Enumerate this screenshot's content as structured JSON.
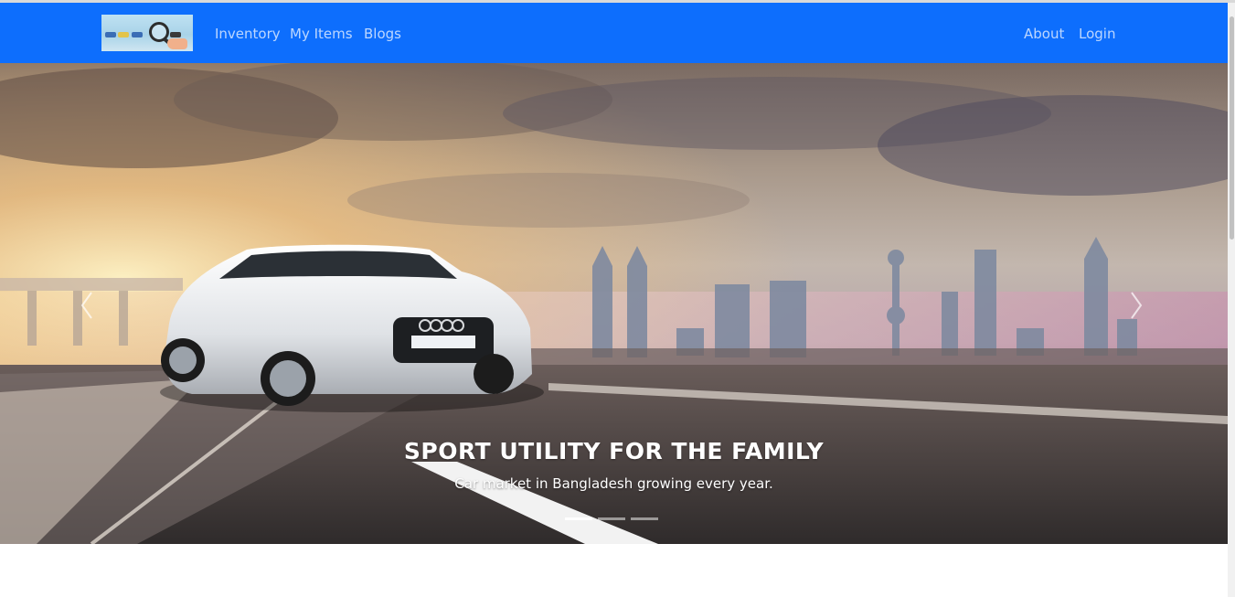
{
  "navbar": {
    "background": "#0d6efd",
    "left_links": [
      "Inventory",
      "My Items",
      "Blogs"
    ],
    "right_links": [
      "About",
      "Login"
    ]
  },
  "carousel": {
    "slide": {
      "title": "SPORT UTILITY FOR THE FAMILY",
      "text": "Car market in Bangladesh growing every year."
    },
    "indicators": {
      "count": 3,
      "active_index": 0
    },
    "controls": [
      "chevron-left-icon",
      "chevron-right-icon"
    ]
  }
}
